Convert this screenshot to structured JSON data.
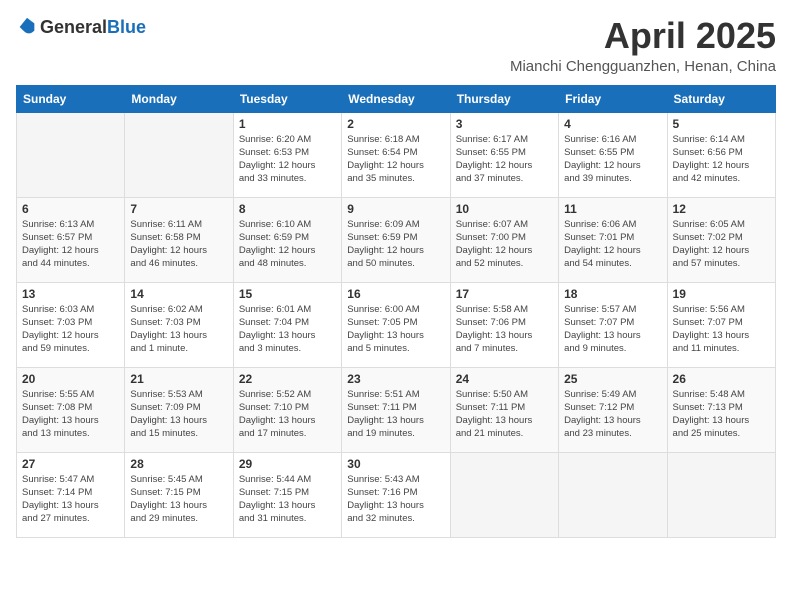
{
  "header": {
    "logo_general": "General",
    "logo_blue": "Blue",
    "month_title": "April 2025",
    "location": "Mianchi Chengguanzhen, Henan, China"
  },
  "weekdays": [
    "Sunday",
    "Monday",
    "Tuesday",
    "Wednesday",
    "Thursday",
    "Friday",
    "Saturday"
  ],
  "weeks": [
    [
      {
        "day": "",
        "info": ""
      },
      {
        "day": "",
        "info": ""
      },
      {
        "day": "1",
        "info": "Sunrise: 6:20 AM\nSunset: 6:53 PM\nDaylight: 12 hours\nand 33 minutes."
      },
      {
        "day": "2",
        "info": "Sunrise: 6:18 AM\nSunset: 6:54 PM\nDaylight: 12 hours\nand 35 minutes."
      },
      {
        "day": "3",
        "info": "Sunrise: 6:17 AM\nSunset: 6:55 PM\nDaylight: 12 hours\nand 37 minutes."
      },
      {
        "day": "4",
        "info": "Sunrise: 6:16 AM\nSunset: 6:55 PM\nDaylight: 12 hours\nand 39 minutes."
      },
      {
        "day": "5",
        "info": "Sunrise: 6:14 AM\nSunset: 6:56 PM\nDaylight: 12 hours\nand 42 minutes."
      }
    ],
    [
      {
        "day": "6",
        "info": "Sunrise: 6:13 AM\nSunset: 6:57 PM\nDaylight: 12 hours\nand 44 minutes."
      },
      {
        "day": "7",
        "info": "Sunrise: 6:11 AM\nSunset: 6:58 PM\nDaylight: 12 hours\nand 46 minutes."
      },
      {
        "day": "8",
        "info": "Sunrise: 6:10 AM\nSunset: 6:59 PM\nDaylight: 12 hours\nand 48 minutes."
      },
      {
        "day": "9",
        "info": "Sunrise: 6:09 AM\nSunset: 6:59 PM\nDaylight: 12 hours\nand 50 minutes."
      },
      {
        "day": "10",
        "info": "Sunrise: 6:07 AM\nSunset: 7:00 PM\nDaylight: 12 hours\nand 52 minutes."
      },
      {
        "day": "11",
        "info": "Sunrise: 6:06 AM\nSunset: 7:01 PM\nDaylight: 12 hours\nand 54 minutes."
      },
      {
        "day": "12",
        "info": "Sunrise: 6:05 AM\nSunset: 7:02 PM\nDaylight: 12 hours\nand 57 minutes."
      }
    ],
    [
      {
        "day": "13",
        "info": "Sunrise: 6:03 AM\nSunset: 7:03 PM\nDaylight: 12 hours\nand 59 minutes."
      },
      {
        "day": "14",
        "info": "Sunrise: 6:02 AM\nSunset: 7:03 PM\nDaylight: 13 hours\nand 1 minute."
      },
      {
        "day": "15",
        "info": "Sunrise: 6:01 AM\nSunset: 7:04 PM\nDaylight: 13 hours\nand 3 minutes."
      },
      {
        "day": "16",
        "info": "Sunrise: 6:00 AM\nSunset: 7:05 PM\nDaylight: 13 hours\nand 5 minutes."
      },
      {
        "day": "17",
        "info": "Sunrise: 5:58 AM\nSunset: 7:06 PM\nDaylight: 13 hours\nand 7 minutes."
      },
      {
        "day": "18",
        "info": "Sunrise: 5:57 AM\nSunset: 7:07 PM\nDaylight: 13 hours\nand 9 minutes."
      },
      {
        "day": "19",
        "info": "Sunrise: 5:56 AM\nSunset: 7:07 PM\nDaylight: 13 hours\nand 11 minutes."
      }
    ],
    [
      {
        "day": "20",
        "info": "Sunrise: 5:55 AM\nSunset: 7:08 PM\nDaylight: 13 hours\nand 13 minutes."
      },
      {
        "day": "21",
        "info": "Sunrise: 5:53 AM\nSunset: 7:09 PM\nDaylight: 13 hours\nand 15 minutes."
      },
      {
        "day": "22",
        "info": "Sunrise: 5:52 AM\nSunset: 7:10 PM\nDaylight: 13 hours\nand 17 minutes."
      },
      {
        "day": "23",
        "info": "Sunrise: 5:51 AM\nSunset: 7:11 PM\nDaylight: 13 hours\nand 19 minutes."
      },
      {
        "day": "24",
        "info": "Sunrise: 5:50 AM\nSunset: 7:11 PM\nDaylight: 13 hours\nand 21 minutes."
      },
      {
        "day": "25",
        "info": "Sunrise: 5:49 AM\nSunset: 7:12 PM\nDaylight: 13 hours\nand 23 minutes."
      },
      {
        "day": "26",
        "info": "Sunrise: 5:48 AM\nSunset: 7:13 PM\nDaylight: 13 hours\nand 25 minutes."
      }
    ],
    [
      {
        "day": "27",
        "info": "Sunrise: 5:47 AM\nSunset: 7:14 PM\nDaylight: 13 hours\nand 27 minutes."
      },
      {
        "day": "28",
        "info": "Sunrise: 5:45 AM\nSunset: 7:15 PM\nDaylight: 13 hours\nand 29 minutes."
      },
      {
        "day": "29",
        "info": "Sunrise: 5:44 AM\nSunset: 7:15 PM\nDaylight: 13 hours\nand 31 minutes."
      },
      {
        "day": "30",
        "info": "Sunrise: 5:43 AM\nSunset: 7:16 PM\nDaylight: 13 hours\nand 32 minutes."
      },
      {
        "day": "",
        "info": ""
      },
      {
        "day": "",
        "info": ""
      },
      {
        "day": "",
        "info": ""
      }
    ]
  ]
}
